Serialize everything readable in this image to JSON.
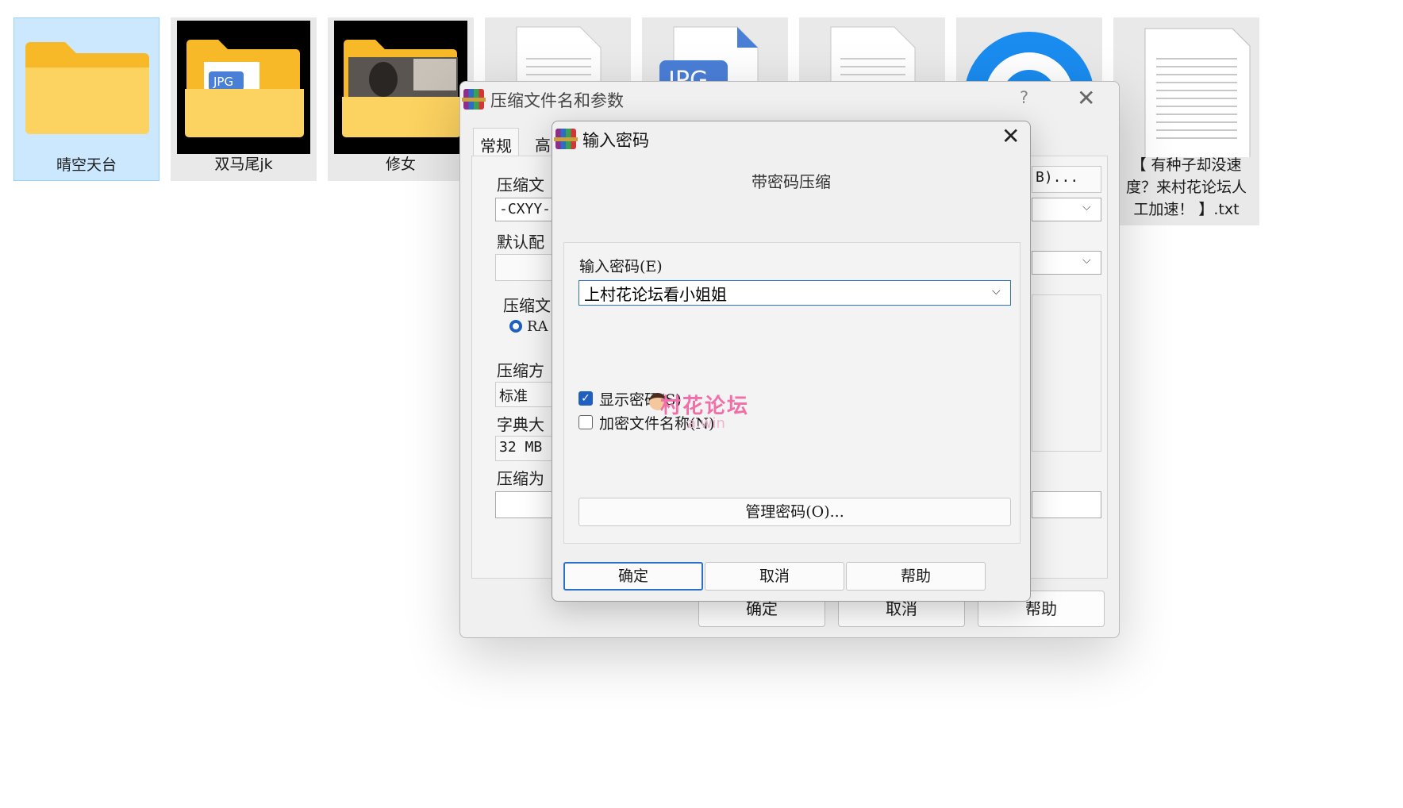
{
  "files": [
    {
      "name": "晴空天台",
      "type": "folder",
      "selected": true
    },
    {
      "name": "双马尾jk",
      "type": "folder-jpg"
    },
    {
      "name": "修女",
      "type": "folder-photo"
    },
    {
      "name": "",
      "type": "document"
    },
    {
      "name": "",
      "type": "jpg-file",
      "badge": "JPG"
    },
    {
      "name": "",
      "type": "document"
    },
    {
      "name": "",
      "type": "app-icon"
    },
    {
      "name": "【 有种子却没速度？来村花论坛人工加速！ 】.txt",
      "type": "text-file"
    }
  ],
  "outer_dialog": {
    "title": "压缩文件名和参数",
    "help_glyph": "?",
    "tabs": [
      "常规",
      "高"
    ],
    "labels": {
      "archive_name": "压缩文",
      "archive_name_value": "-CXYY-",
      "browse_button": "B)...",
      "default_profile": "默认配",
      "format_group": "压缩文",
      "format_radio": "RA",
      "method": "压缩方",
      "method_value": "标准",
      "dict": "字典大",
      "dict_value": "32 MB",
      "split": "压缩为"
    },
    "buttons": {
      "ok": "确定",
      "cancel": "取消",
      "help": "帮助"
    }
  },
  "password_dialog": {
    "title": "输入密码",
    "heading": "带密码压缩",
    "password_label": "输入密码(E)",
    "password_value": "上村花论坛看小姐姐",
    "show_password": {
      "label": "显示密码(S)",
      "checked": true
    },
    "encrypt_names": {
      "label": "加密文件名称(N)",
      "checked": false
    },
    "manage_button": "管理密码(O)...",
    "buttons": {
      "ok": "确定",
      "cancel": "取消",
      "help": "帮助"
    }
  },
  "watermark": {
    "text": "村花论坛",
    "subtext": "a.win"
  },
  "colors": {
    "selection": "#cce8ff",
    "accent": "#2b70c9",
    "folder": "#f9c24a",
    "watermark": "#f06fa8"
  }
}
